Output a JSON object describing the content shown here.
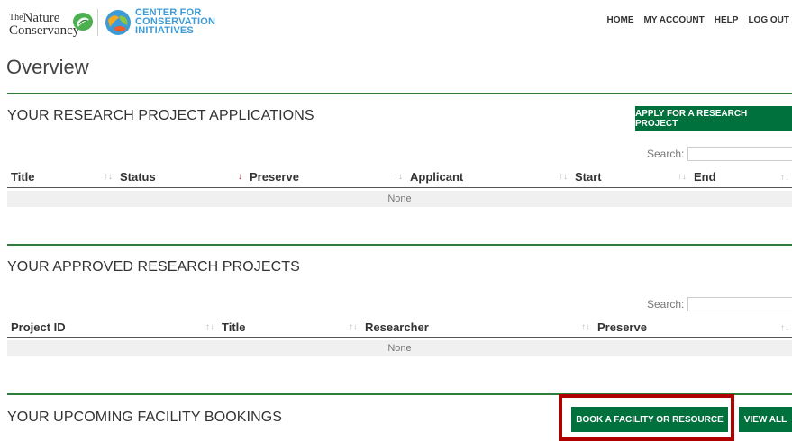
{
  "header": {
    "tnc_logo": {
      "the": "The",
      "line1": "Nature",
      "line2": "Conservancy"
    },
    "cci_logo": {
      "line1": "CENTER FOR",
      "line2": "CONSERVATION",
      "line3": "INITIATIVES"
    },
    "nav": [
      "HOME",
      "MY ACCOUNT",
      "HELP",
      "LOG OUT"
    ]
  },
  "page_title": "Overview",
  "applications": {
    "title": "YOUR RESEARCH PROJECT APPLICATIONS",
    "button": "APPLY FOR A RESEARCH PROJECT",
    "search_label": "Search:",
    "columns": [
      "Title",
      "Status",
      "Preserve",
      "Applicant",
      "Start",
      "End"
    ],
    "empty_text": "None"
  },
  "approved": {
    "title": "YOUR APPROVED RESEARCH PROJECTS",
    "search_label": "Search:",
    "columns": [
      "Project ID",
      "Title",
      "Researcher",
      "Preserve"
    ],
    "empty_text": "None"
  },
  "bookings": {
    "title": "YOUR UPCOMING FACILITY BOOKINGS",
    "book_button": "BOOK A FACILITY OR RESOURCE",
    "view_all_button": "VIEW ALL"
  },
  "colors": {
    "brand_green": "#00703c",
    "rule_green": "#2f7d3a",
    "highlight_red": "#b10000",
    "cci_blue": "#3d9bd5"
  },
  "icons": {
    "sort": "sort-arrows-icon",
    "sort_desc": "sort-desc-icon",
    "sort_asc": "sort-asc-icon"
  }
}
